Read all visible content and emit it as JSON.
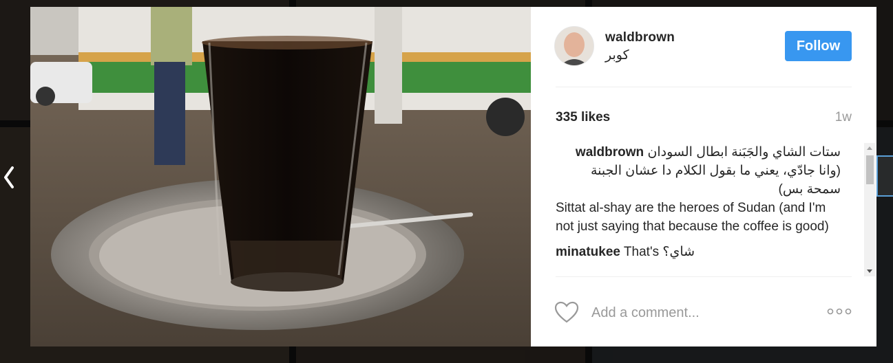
{
  "post": {
    "username": "waldbrown",
    "location": "كوبر",
    "follow_label": "Follow",
    "likes": "335 likes",
    "time_ago": "1w",
    "comment_placeholder": "Add a comment..."
  },
  "comments": [
    {
      "user": "waldbrown",
      "text_ar": "ستات الشاي والجَبَنة ابطال السودان (وانا جادّي، يعني ما بقول الكلام دا عشان الجبنة سمحة بس)",
      "text_en": "Sittat al-shay are the heroes of Sudan (and I'm not just saying that because the coffee is good)"
    },
    {
      "user": "minatukee",
      "text": "That's شاي؟"
    }
  ],
  "icons": {
    "prev": "chevron-left-icon",
    "like": "heart-outline-icon",
    "more": "more-options-icon"
  },
  "colors": {
    "follow_bg": "#3897f0",
    "text": "#262626",
    "muted": "#999999"
  }
}
